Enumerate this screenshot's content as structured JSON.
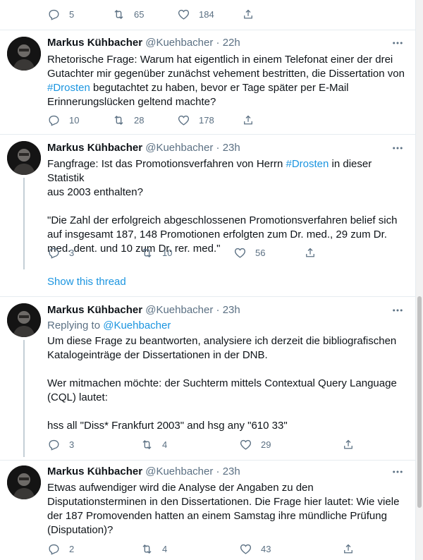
{
  "top_actions": {
    "replies": "5",
    "retweets": "65",
    "likes": "184"
  },
  "tweets": [
    {
      "name": "Markus Kühbacher",
      "handle": "@Kuehbacher",
      "time": "22h",
      "text_before": "Rhetorische Frage: Warum hat eigentlich in einem Telefonat einer der drei\nGutachter mir gegenüber zunächst vehement bestritten, die Dissertation von\n",
      "hashtag": "#Drosten",
      "text_after": " begutachtet zu haben, bevor er Tage später per E-Mail\nErinnerungslücken geltend machte?",
      "replies": "10",
      "retweets": "28",
      "likes": "178"
    },
    {
      "name": "Markus Kühbacher",
      "handle": "@Kuehbacher",
      "time": "23h",
      "text_before": "Fangfrage: Ist das Promotionsverfahren von Herrn ",
      "hashtag": "#Drosten",
      "text_after": " in dieser Statistik\naus 2003 enthalten?\n\n\"Die Zahl der erfolgreich abgeschlossenen Promotionsverfahren belief sich\nauf insgesamt 187, 148 Promotionen erfolgten zum Dr. med., 29 zum Dr.\nmed. dent. und 10 zum Dr. rer. med.\"",
      "replies": "3",
      "retweets": "10",
      "likes": "56",
      "show_thread": "Show this thread"
    },
    {
      "name": "Markus Kühbacher",
      "handle": "@Kuehbacher",
      "time": "23h",
      "replying_label": "Replying to ",
      "replying_handle": "@Kuehbacher",
      "text": "Um diese Frage zu beantworten, analysiere ich derzeit die bibliografischen\nKatalogeinträge der Dissertationen in der DNB.\n\nWer mitmachen möchte: der Suchterm mittels Contextual Query Language\n(CQL) lautet:\n\nhss all \"Diss* Frankfurt 2003\" and hsg any \"610 33\"",
      "replies": "3",
      "retweets": "4",
      "likes": "29"
    },
    {
      "name": "Markus Kühbacher",
      "handle": "@Kuehbacher",
      "time": "23h",
      "text": "Etwas aufwendiger wird die Analyse der Angaben zu den\nDisputationsterminen in den Dissertationen. Die Frage hier lautet: Wie viele\nder 187 Promovenden hatten an einem Samstag ihre mündliche Prüfung\n(Disputation)?",
      "replies": "2",
      "retweets": "4",
      "likes": "43"
    }
  ],
  "dot": "·",
  "icons": {
    "reply": "reply-icon",
    "retweet": "retweet-icon",
    "like": "heart-icon",
    "share": "share-icon",
    "more": "more-icon"
  }
}
